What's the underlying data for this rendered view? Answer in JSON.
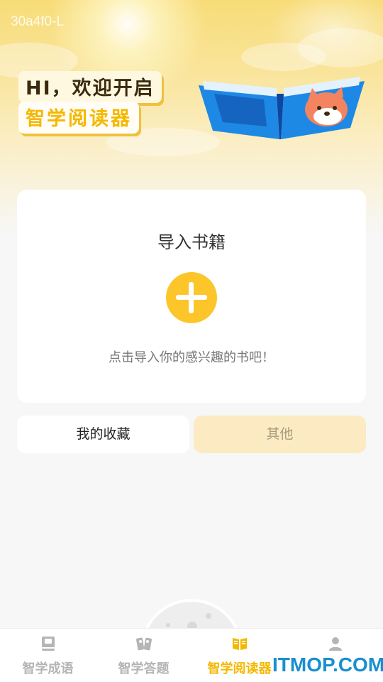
{
  "device_id": "30a4f0-L",
  "header": {
    "greeting": "HI，欢迎开启",
    "app_title": "智学阅读器"
  },
  "import_card": {
    "title": "导入书籍",
    "hint": "点击导入你的感兴趣的书吧！"
  },
  "tabs": [
    {
      "label": "我的收藏",
      "active": true
    },
    {
      "label": "其他",
      "active": false
    }
  ],
  "bottom_nav": {
    "items": [
      {
        "label": "智学成语",
        "icon": "book-icon",
        "active": false
      },
      {
        "label": "智学答题",
        "icon": "quiz-icon",
        "active": false
      },
      {
        "label": "智学阅读器",
        "icon": "open-book-icon",
        "active": true
      },
      {
        "label": "",
        "icon": "user-icon",
        "active": false
      }
    ]
  },
  "watermark": "ITMOP.COM",
  "colors": {
    "accent": "#fcc52a",
    "active_nav": "#f5b800",
    "inactive_nav": "#b5b5b5",
    "other_tab_bg": "#fcebc2"
  }
}
